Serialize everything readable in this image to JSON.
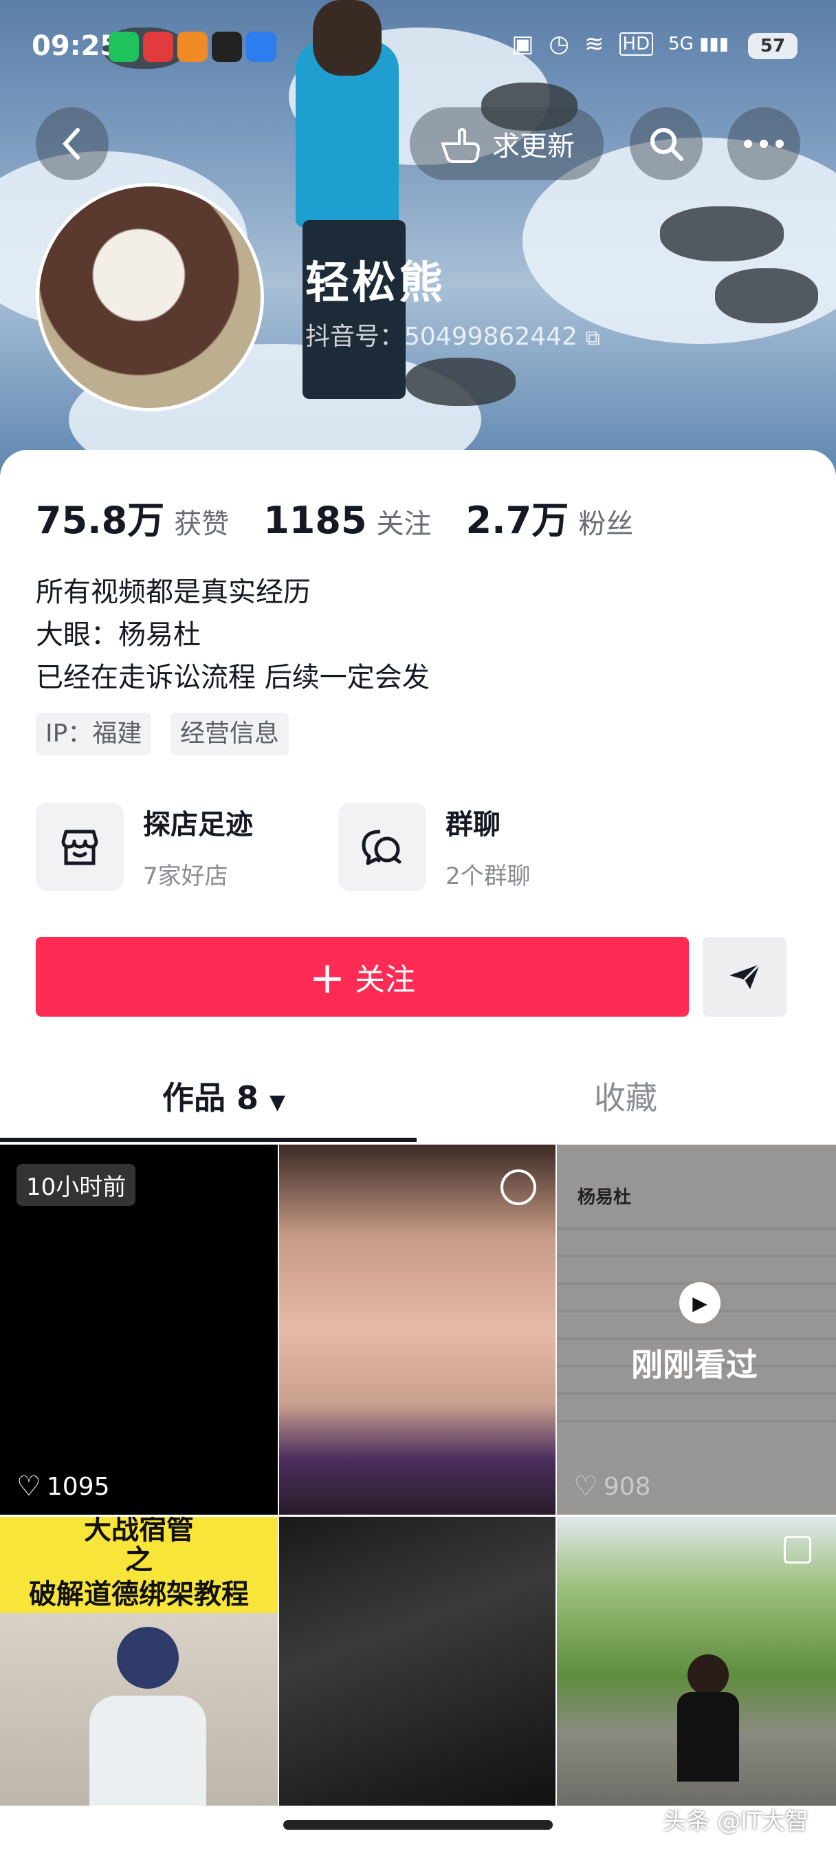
{
  "status": {
    "time": "09:25",
    "battery": "57",
    "network": "5G"
  },
  "header": {
    "request_update_label": "求更新",
    "back_icon": "chevron-left-icon",
    "search_icon": "search-icon",
    "more_icon": "more-dots-icon"
  },
  "profile": {
    "nickname": "轻松熊",
    "douyin_id": "抖音号：50499862442",
    "stats": [
      {
        "value": "75.8万",
        "label": "获赞"
      },
      {
        "value": "1185",
        "label": "关注"
      },
      {
        "value": "2.7万",
        "label": "粉丝"
      }
    ],
    "bio": [
      "所有视频都是真实经历",
      "大眼：杨易杜",
      "已经在走诉讼流程 后续一定会发"
    ],
    "tags": [
      "IP：福建",
      "经营信息"
    ]
  },
  "features": [
    {
      "title": "探店足迹",
      "subtitle": "7家好店",
      "icon": "store-icon"
    },
    {
      "title": "群聊",
      "subtitle": "2个群聊",
      "icon": "chat-bubbles-icon"
    }
  ],
  "actions": {
    "follow_label": "关注",
    "share_icon": "send-icon"
  },
  "tabs": {
    "works": "作品 8",
    "favorites": "收藏"
  },
  "grid": {
    "cell1_time": "10小时前",
    "cell1_likes": "1095",
    "cell3_header": "杨易杜",
    "cell3_likes": "908",
    "cell3_seen": "刚刚看过",
    "cell4_caption_line1": "大战宿管",
    "cell4_caption_line2": "之",
    "cell4_caption_line3": "破解道德绑架教程"
  },
  "watermark": "头条 @IT大智",
  "colors": {
    "accent": "#fe2c55",
    "text_primary": "#161823",
    "text_secondary": "#8a8c92"
  }
}
